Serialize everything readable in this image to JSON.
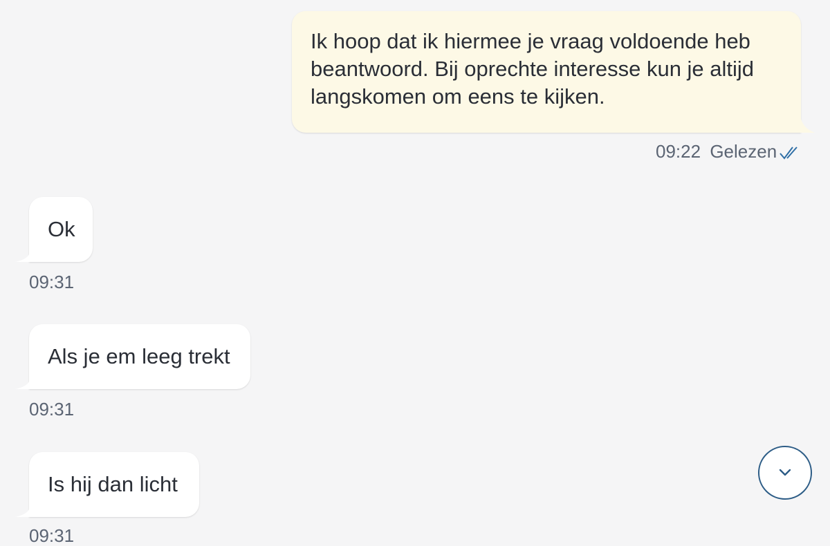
{
  "conversation": {
    "outgoing": {
      "text": "Ik hoop dat ik hiermee je vraag voldoende heb beantwoord. Bij oprechte interesse kun je altijd langskomen om eens te kijken.",
      "time": "09:22",
      "status": "Gelezen",
      "status_icon": "double-check-icon"
    },
    "incoming": [
      {
        "text": "Ok",
        "time": "09:31"
      },
      {
        "text": "Als je em leeg trekt",
        "time": "09:31"
      },
      {
        "text": "Is hij dan licht",
        "time": "09:31"
      }
    ]
  },
  "scroll_button": {
    "icon": "chevron-down-icon"
  },
  "colors": {
    "background": "#f5f5f6",
    "outgoing_bubble": "#fdf9e6",
    "incoming_bubble": "#ffffff",
    "accent": "#2c5c86",
    "read_tick": "#2f6fa6"
  }
}
